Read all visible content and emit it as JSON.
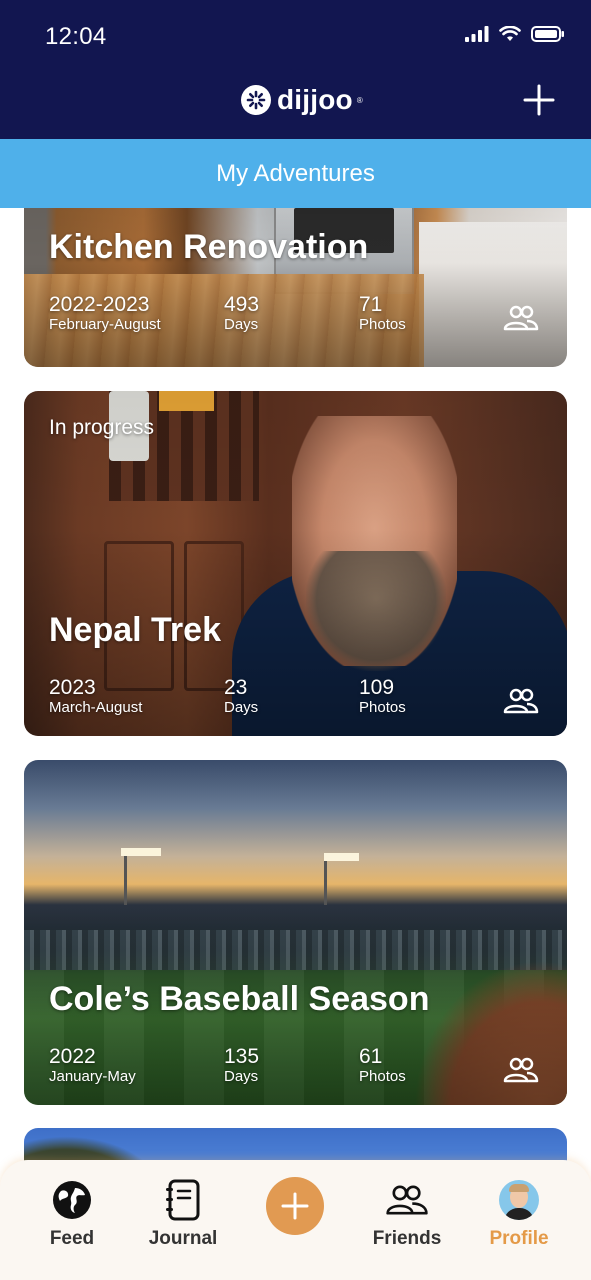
{
  "status_bar": {
    "time": "12:04"
  },
  "header": {
    "logo_text": "dijjoo",
    "logo_tm": "®"
  },
  "tab": {
    "title": "My Adventures"
  },
  "cards": [
    {
      "title": "Kitchen Renovation",
      "status": "",
      "period": "2022-2023",
      "months": "February-August",
      "days": "493",
      "days_label": "Days",
      "photos": "71",
      "photos_label": "Photos"
    },
    {
      "title": "Nepal Trek",
      "status": "In progress",
      "period": "2023",
      "months": "March-August",
      "days": "23",
      "days_label": "Days",
      "photos": "109",
      "photos_label": "Photos"
    },
    {
      "title": "Cole’s Baseball Season",
      "status": "",
      "period": "2022",
      "months": "January-May",
      "days": "135",
      "days_label": "Days",
      "photos": "61",
      "photos_label": "Photos"
    }
  ],
  "nav": {
    "feed": "Feed",
    "journal": "Journal",
    "friends": "Friends",
    "profile": "Profile",
    "active_color": "#e49a48"
  },
  "colors": {
    "header_bg": "#121650",
    "tab_bg": "#4fb0ea",
    "fab": "#e19a52"
  }
}
